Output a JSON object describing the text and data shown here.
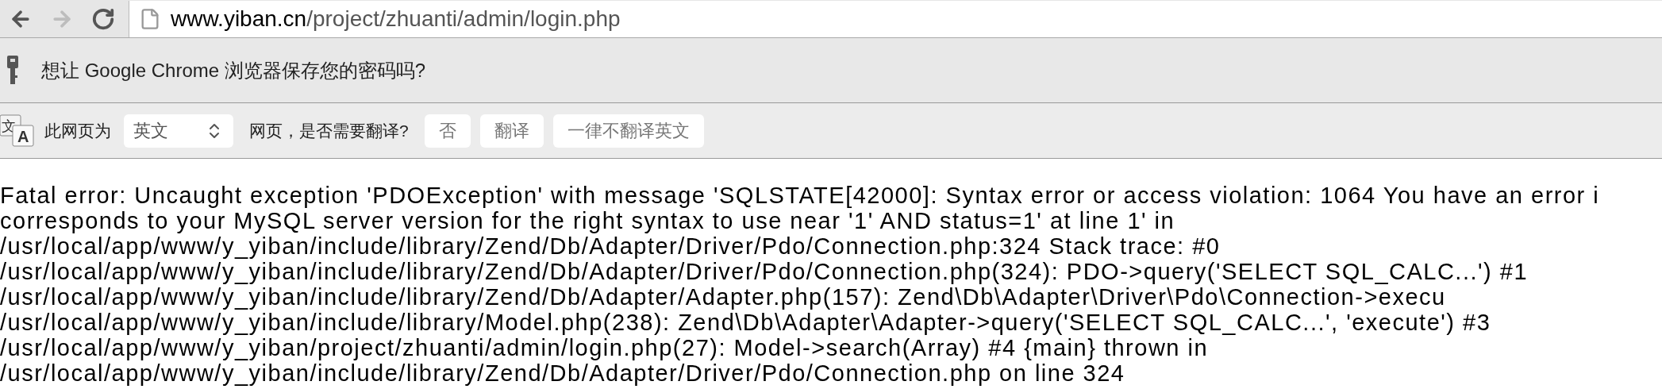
{
  "toolbar": {
    "nav": [
      {
        "kind": "back",
        "disabled": false
      },
      {
        "kind": "forward",
        "disabled": true
      },
      {
        "kind": "reload",
        "disabled": false
      }
    ],
    "url_host": "www.yiban.cn",
    "url_path": "/project/zhuanti/admin/login.php"
  },
  "password_bar": {
    "message": "想让 Google Chrome 浏览器保存您的密码吗?"
  },
  "translate_bar": {
    "icon_letters": [
      "文",
      "A"
    ],
    "label": "此网页为",
    "language": "英文",
    "question": "网页，是否需要翻译?",
    "buttons": [
      "否",
      "翻译",
      "一律不翻译英文"
    ]
  },
  "error_lines": [
    "Fatal error: Uncaught exception 'PDOException' with message 'SQLSTATE[42000]: Syntax error or access violation: 1064 You have an error i",
    "corresponds to your MySQL server version for the right syntax to use near '1' AND status=1' at line 1' in",
    "/usr/local/app/www/y_yiban/include/library/Zend/Db/Adapter/Driver/Pdo/Connection.php:324 Stack trace: #0",
    "/usr/local/app/www/y_yiban/include/library/Zend/Db/Adapter/Driver/Pdo/Connection.php(324): PDO->query('SELECT SQL_CALC...') #1",
    "/usr/local/app/www/y_yiban/include/library/Zend/Db/Adapter/Adapter.php(157): Zend\\Db\\Adapter\\Driver\\Pdo\\Connection->execu",
    "/usr/local/app/www/y_yiban/include/library/Model.php(238): Zend\\Db\\Adapter\\Adapter->query('SELECT SQL_CALC...', 'execute') #3",
    "/usr/local/app/www/y_yiban/project/zhuanti/admin/login.php(27): Model->search(Array) #4 {main} thrown in",
    "/usr/local/app/www/y_yiban/include/library/Zend/Db/Adapter/Driver/Pdo/Connection.php on line 324"
  ]
}
